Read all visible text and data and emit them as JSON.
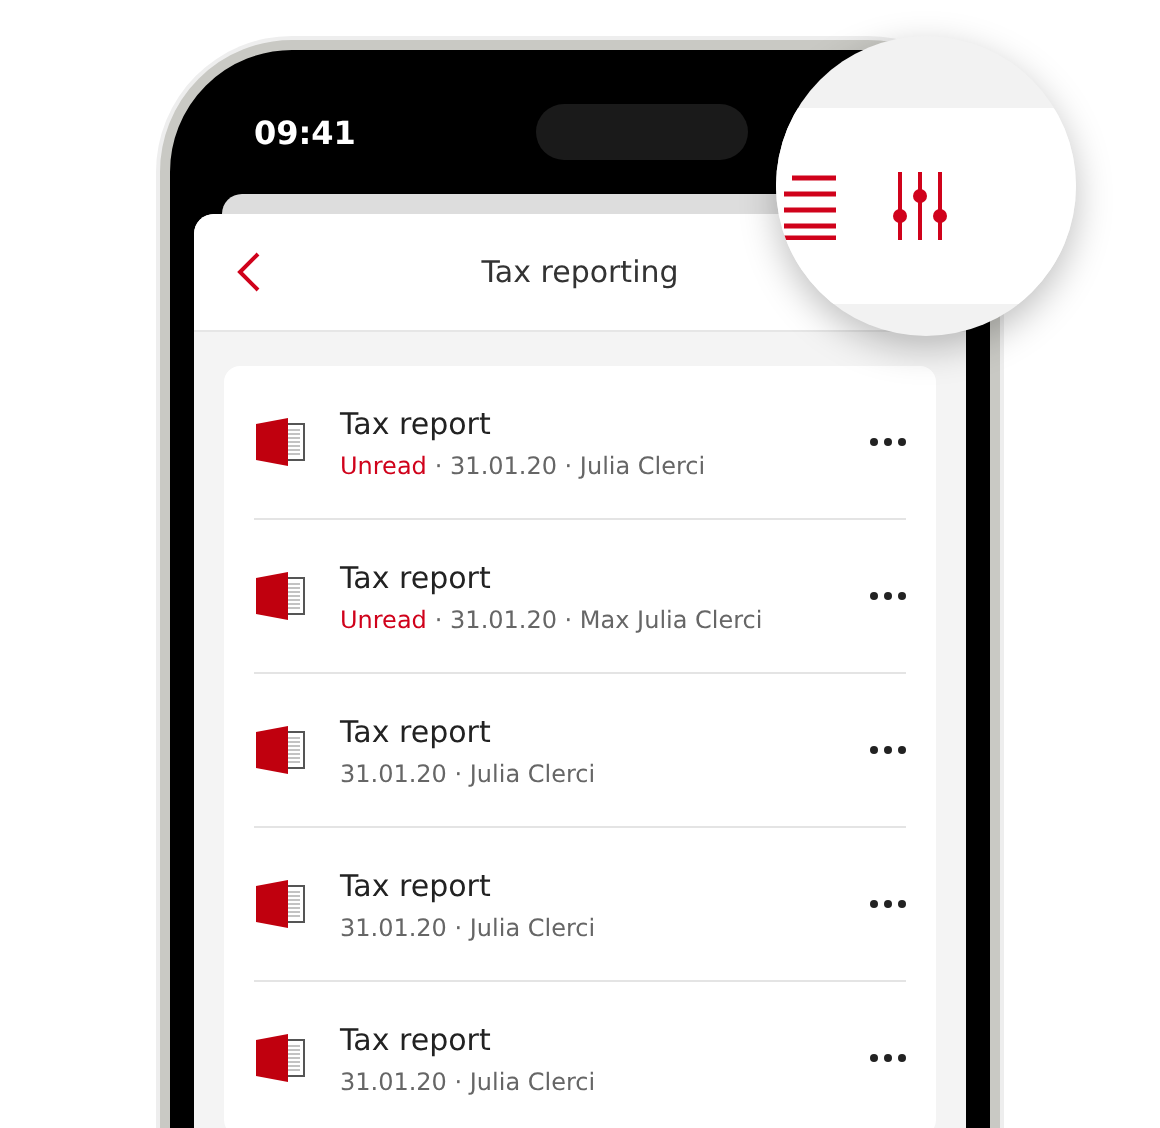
{
  "status_bar": {
    "time": "09:41"
  },
  "header": {
    "title": "Tax reporting"
  },
  "items": [
    {
      "title": "Tax report",
      "status": "Unread",
      "meta": "· 31.01.20 · Julia Clerci"
    },
    {
      "title": "Tax report",
      "status": "Unread",
      "meta": "· 31.01.20 · Max Julia Clerci"
    },
    {
      "title": "Tax report",
      "meta": "31.01.20 · Julia Clerci"
    },
    {
      "title": "Tax report",
      "meta": "31.01.20 · Julia Clerci"
    },
    {
      "title": "Tax report",
      "meta": "31.01.20 · Julia Clerci"
    }
  ]
}
